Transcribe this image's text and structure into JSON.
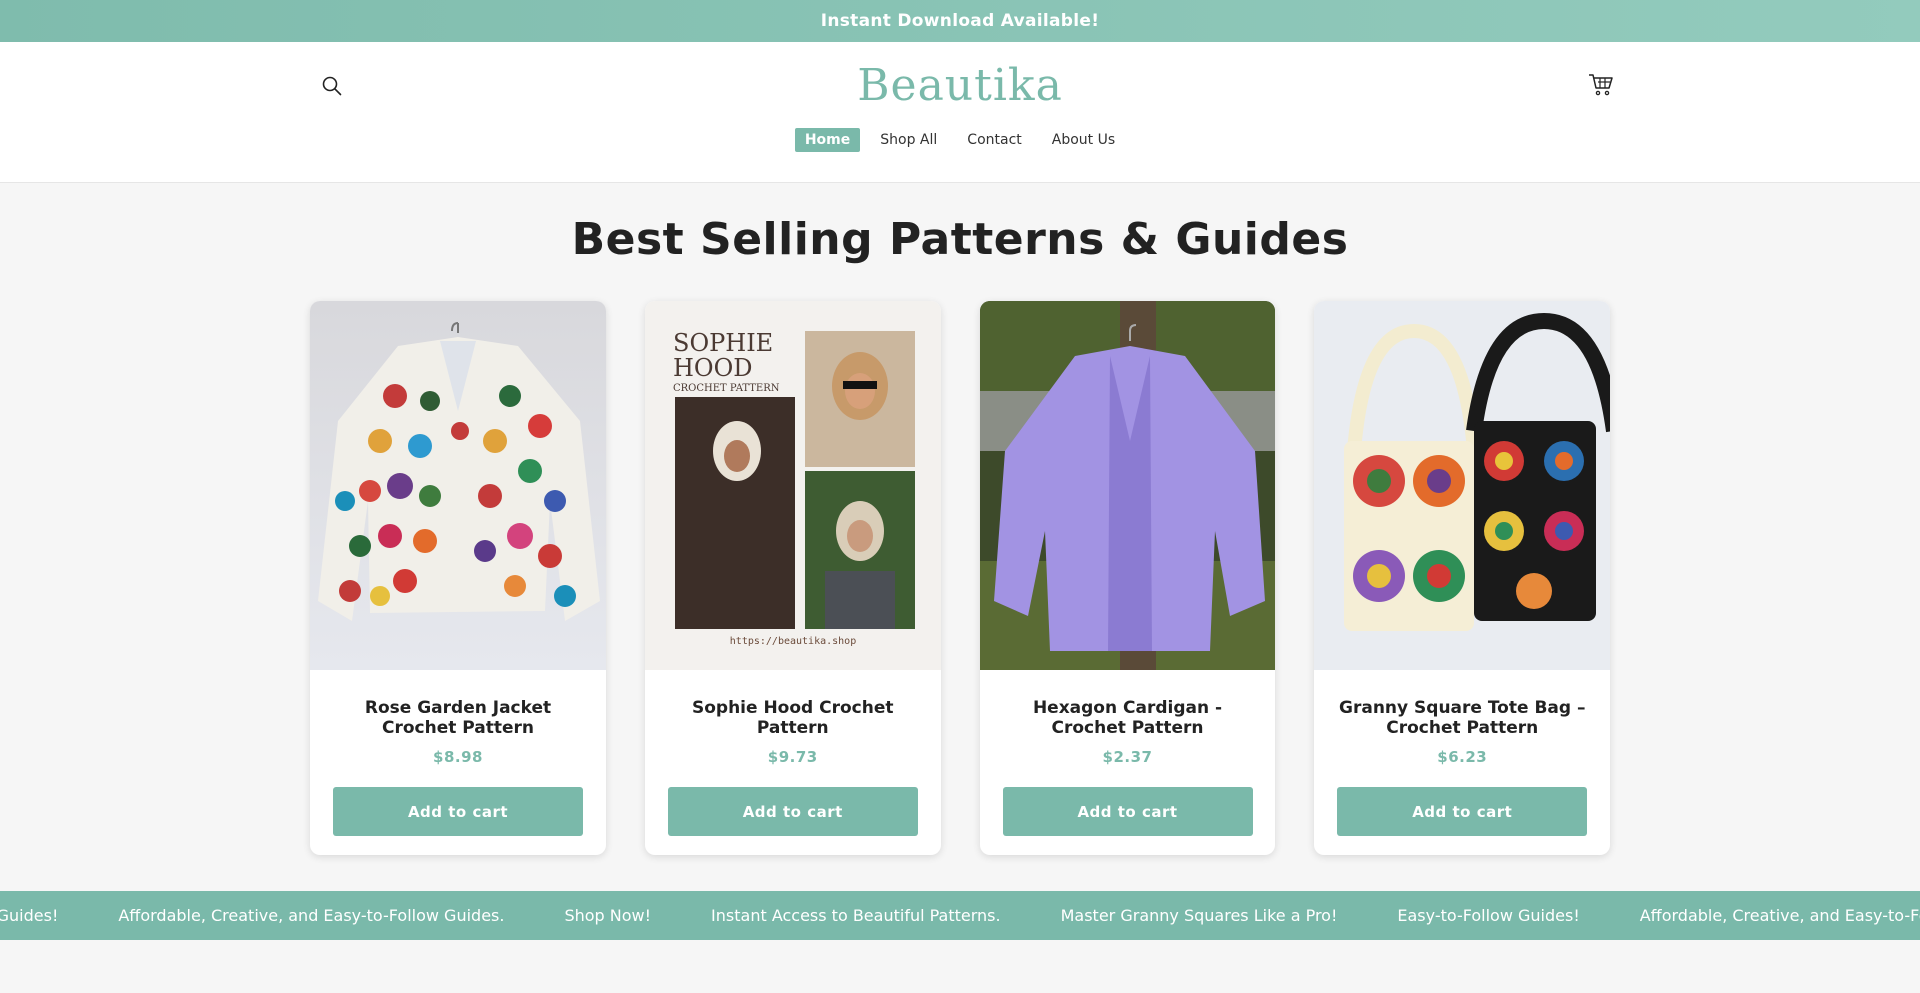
{
  "announcement": {
    "text": "Instant Download Available!"
  },
  "header": {
    "logo": "Beautika",
    "search_icon": "search-icon",
    "cart_icon": "cart-icon",
    "nav": [
      {
        "label": "Home",
        "active": true
      },
      {
        "label": "Shop All",
        "active": false
      },
      {
        "label": "Contact",
        "active": false
      },
      {
        "label": "About Us",
        "active": false
      }
    ]
  },
  "section": {
    "title": "Best Selling Patterns & Guides"
  },
  "products": [
    {
      "title": "Rose Garden Jacket Crochet Pattern",
      "price": "$8.98",
      "button": "Add to cart",
      "image": "cardigan-with-flowers-image"
    },
    {
      "title": "Sophie Hood Crochet Pattern",
      "price": "$9.73",
      "button": "Add to cart",
      "image": "sophie-hood-collage-image",
      "image_text": {
        "line1": "SOPHIE",
        "line2": "HOOD",
        "line3": "CROCHET PATTERN",
        "url": "https://beautika.shop"
      }
    },
    {
      "title": "Hexagon Cardigan - Crochet Pattern",
      "price": "$2.37",
      "button": "Add to cart",
      "image": "lilac-cardigan-image"
    },
    {
      "title": "Granny Square Tote Bag – Crochet Pattern",
      "price": "$6.23",
      "button": "Add to cart",
      "image": "granny-square-bags-image"
    }
  ],
  "marquee": {
    "items": [
      "Easy-to-Follow Guides!",
      "Affordable, Creative, and Easy-to-Follow Guides.",
      "Shop Now!",
      "Instant Access to Beautiful Patterns.",
      "Master Granny Squares Like a Pro!",
      "Easy-to-Follow Guides!",
      "Affordable, Creative, and Easy-to-Follow Guides."
    ]
  },
  "colors": {
    "accent": "#7ab9aa",
    "announcement": "#86c1b3"
  }
}
